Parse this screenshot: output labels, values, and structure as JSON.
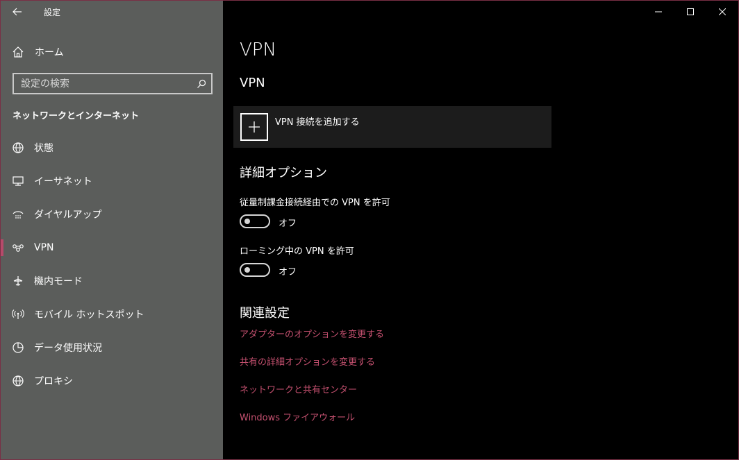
{
  "app": {
    "title": "設定"
  },
  "sidebar": {
    "home_label": "ホーム",
    "search": {
      "placeholder": "設定の検索"
    },
    "section_title": "ネットワークとインターネット",
    "items": [
      {
        "label": "状態",
        "icon": "globe-status-icon"
      },
      {
        "label": "イーサネット",
        "icon": "ethernet-icon"
      },
      {
        "label": "ダイヤルアップ",
        "icon": "dialup-icon"
      },
      {
        "label": "VPN",
        "icon": "vpn-icon",
        "active": true
      },
      {
        "label": "機内モード",
        "icon": "airplane-icon"
      },
      {
        "label": "モバイル ホットスポット",
        "icon": "hotspot-icon"
      },
      {
        "label": "データ使用状況",
        "icon": "data-usage-icon"
      },
      {
        "label": "プロキシ",
        "icon": "globe-icon"
      }
    ]
  },
  "main": {
    "page_title": "VPN",
    "vpn_section_title": "VPN",
    "add_vpn_label": "VPN 接続を追加する",
    "advanced_title": "詳細オプション",
    "options": [
      {
        "label": "従量制課金接続経由での VPN を許可",
        "state": "オフ"
      },
      {
        "label": "ローミング中の VPN を許可",
        "state": "オフ"
      }
    ],
    "related_title": "関連設定",
    "links": [
      "アダプターのオプションを変更する",
      "共有の詳細オプションを変更する",
      "ネットワークと共有センター",
      "Windows ファイアウォール"
    ]
  },
  "colors": {
    "sidebar_bg": "#5b5d5b",
    "main_bg": "#000000",
    "accent": "#b74a6a",
    "link": "#c4506f"
  }
}
